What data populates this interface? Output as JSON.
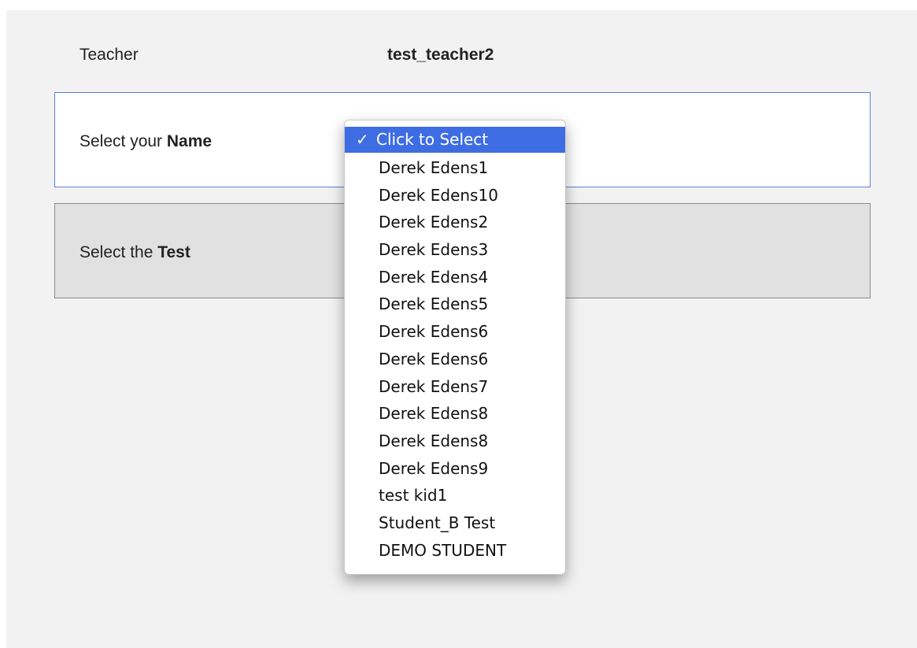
{
  "teacher": {
    "label": "Teacher",
    "value": "test_teacher2"
  },
  "name_row": {
    "prefix": "Select your ",
    "bold": "Name"
  },
  "test_row": {
    "prefix": "Select the ",
    "bold": "Test"
  },
  "dropdown": {
    "selected_check": "✓",
    "options": [
      "Click to Select",
      "Derek Edens1",
      "Derek Edens10",
      "Derek Edens2",
      "Derek Edens3",
      "Derek Edens4",
      "Derek Edens5",
      "Derek Edens6",
      "Derek Edens6",
      "Derek Edens7",
      "Derek Edens8",
      "Derek Edens8",
      "Derek Edens9",
      "test kid1",
      "Student_B Test",
      "DEMO STUDENT"
    ]
  },
  "colors": {
    "highlight": "#3e6de3",
    "active_border": "#5a7fd9",
    "panel_bg": "#f2f2f2",
    "inactive_row_bg": "#e1e1e1"
  }
}
